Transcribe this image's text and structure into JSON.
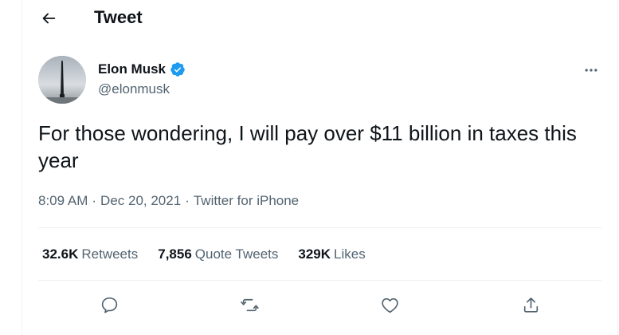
{
  "header": {
    "back_icon": "arrow-left-icon",
    "title": "Tweet"
  },
  "tweet": {
    "author": {
      "name": "Elon Musk",
      "handle": "@elonmusk",
      "verified": true,
      "avatar_icon": "avatar"
    },
    "more_icon": "more-horizontal-icon",
    "text": "For those wondering, I will pay over $11 billion in taxes this year",
    "time": "8:09 AM",
    "date": "Dec 20, 2021",
    "separator": "·",
    "source": "Twitter for iPhone",
    "stats": [
      {
        "value": "32.6K",
        "label": "Retweets"
      },
      {
        "value": "7,856",
        "label": "Quote Tweets"
      },
      {
        "value": "329K",
        "label": "Likes"
      }
    ],
    "actions": [
      {
        "icon": "reply-icon"
      },
      {
        "icon": "retweet-icon"
      },
      {
        "icon": "like-icon"
      },
      {
        "icon": "share-icon"
      }
    ]
  },
  "colors": {
    "text": "#0f1419",
    "muted": "#536471",
    "verified": "#1d9bf0",
    "border": "#eff3f4"
  }
}
